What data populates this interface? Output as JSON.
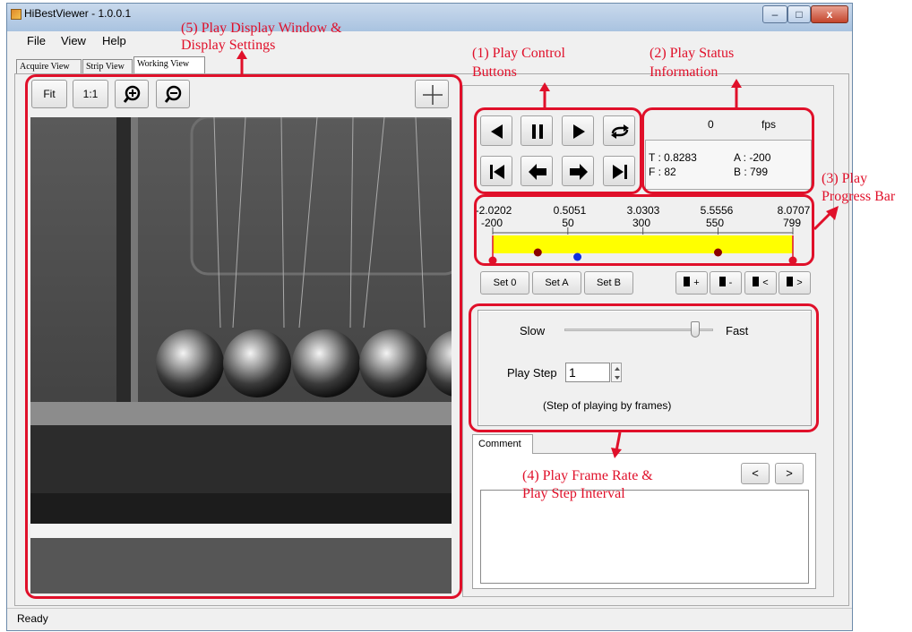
{
  "window": {
    "title": "HiBestViewer - 1.0.0.1",
    "minimize": "–",
    "maximize": "□",
    "close": "x"
  },
  "menu": [
    "File",
    "View",
    "Help"
  ],
  "tabs": [
    "Acquire View",
    "Strip View",
    "Working View"
  ],
  "toolbar": {
    "fit": "Fit",
    "one_to_one": "1:1",
    "zoom_in_icon": "zoom-in-icon",
    "zoom_out_icon": "zoom-out-icon",
    "crosshair_icon": "crosshair-icon"
  },
  "controls": {
    "row1": [
      "play-backward-icon",
      "pause-icon",
      "play-forward-icon",
      "loop-icon"
    ],
    "row2": [
      "skip-to-start-icon",
      "step-back-icon",
      "step-forward-icon",
      "skip-to-end-icon"
    ]
  },
  "status": {
    "fps_value": "0",
    "fps_unit": "fps",
    "t": "T : 0.8283",
    "f": "F : 82",
    "a": "A : -200",
    "b": "B : 799"
  },
  "progress": {
    "time_ticks": [
      "-2.0202",
      "0.5051",
      "3.0303",
      "5.5556",
      "8.0707"
    ],
    "frame_ticks": [
      "-200",
      "50",
      "300",
      "550",
      "799"
    ],
    "frame_min": -200,
    "frame_max": 799,
    "markers": {
      "red_start": -200,
      "red_end": 799,
      "dark_a": -50,
      "dark_b": 550,
      "current": 82
    },
    "bar_color": "#ffff00"
  },
  "set_buttons": [
    "Set 0",
    "Set A",
    "Set B"
  ],
  "bookmark_buttons": [
    "+",
    "-",
    "<",
    ">"
  ],
  "speed": {
    "slow": "Slow",
    "fast": "Fast",
    "level": 0.88
  },
  "play_step": {
    "label": "Play Step",
    "value": "1",
    "note": "(Step of playing by frames)"
  },
  "comment": {
    "tab": "Comment",
    "prev": "<",
    "next": ">",
    "text": ""
  },
  "statusbar": "Ready",
  "annotations": {
    "a1": "(1) Play Control",
    "a1b": "Buttons",
    "a2": "(2) Play Status",
    "a2b": "Information",
    "a3": "(3) Play",
    "a3b": "Progress Bar",
    "a4": "(4) Play Frame Rate &",
    "a4b": "Play Step Interval",
    "a5": "(5) Play Display Window &",
    "a5b": "Display Settings"
  },
  "colors": {
    "annotation_red": "#e0102a",
    "marker_red": "#e0102a",
    "marker_dark": "#8b0000",
    "marker_current": "#1030e0"
  }
}
